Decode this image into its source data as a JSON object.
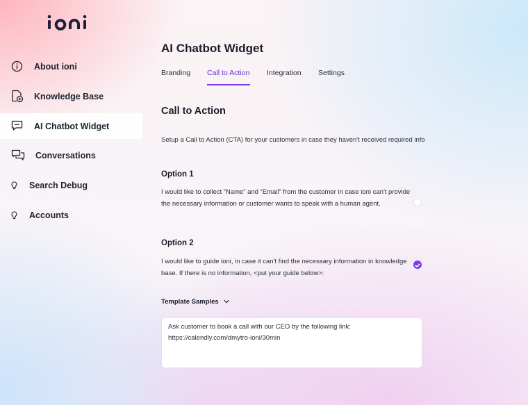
{
  "brand": {
    "logo_text": "ioni",
    "accent": "#7c3ce6"
  },
  "sidebar": {
    "items": [
      {
        "label": "About ioni",
        "icon": "info-circle-icon",
        "active": false
      },
      {
        "label": "Knowledge Base",
        "icon": "document-add-icon",
        "active": false
      },
      {
        "label": "AI Chatbot Widget",
        "icon": "chat-bubble-icon",
        "active": true
      },
      {
        "label": "Conversations",
        "icon": "conversations-icon",
        "active": false
      },
      {
        "label": "Search Debug",
        "icon": "lightbulb-icon",
        "active": false
      },
      {
        "label": "Accounts",
        "icon": "lightbulb-icon",
        "active": false
      }
    ]
  },
  "main": {
    "title": "AI Chatbot Widget",
    "tabs": [
      {
        "label": "Branding",
        "active": false
      },
      {
        "label": "Call to Action",
        "active": true
      },
      {
        "label": "Integration",
        "active": false
      },
      {
        "label": "Settings",
        "active": false
      }
    ],
    "section_title": "Call to Action",
    "description": "Setup a Call to Action (CTA) for your customers in case they haven't received required info",
    "option1": {
      "title": "Option 1",
      "text": "I would like to collect “Name” and “Email” from the customer in case ioni can't provide the necessary information or customer wants to speak with a human agent.",
      "selected": false
    },
    "option2": {
      "title": "Option 2",
      "text": "I would like to guide ioni, in case it can't find the necessary information in knowledge base. If there is no information, <put your guide below>:",
      "selected": true
    },
    "template_samples_label": "Template Samples",
    "guide_text": "Ask customer to book a call with our CEO by the following link:\nhttps://calendly.com/dmytro-ioni/30min"
  }
}
